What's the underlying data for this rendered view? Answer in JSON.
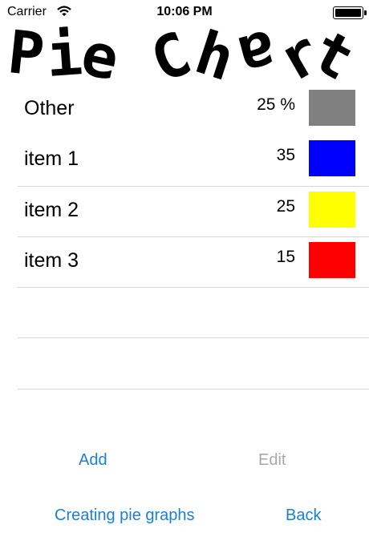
{
  "status_bar": {
    "carrier": "Carrier",
    "time": "10:06 PM",
    "wifi_icon": "wifi-icon",
    "battery_icon": "battery-icon"
  },
  "title": {
    "text": "Pie Chart",
    "letters": [
      "P",
      "i",
      "e",
      "C",
      "h",
      "a",
      "r",
      "t"
    ]
  },
  "table": {
    "other": {
      "label": "Other",
      "value": "25 %",
      "color": "#808080"
    },
    "items": [
      {
        "label": "item 1",
        "value": "35",
        "color": "#0000ff"
      },
      {
        "label": "item 2",
        "value": "25",
        "color": "#ffff00"
      },
      {
        "label": "item 3",
        "value": "15",
        "color": "#ff0000"
      }
    ]
  },
  "toolbar": {
    "add_label": "Add",
    "edit_label": "Edit",
    "creating_label": "Creating pie graphs",
    "back_label": "Back"
  },
  "colors": {
    "accent": "#1a7fd6",
    "disabled": "#a8a8a8"
  }
}
